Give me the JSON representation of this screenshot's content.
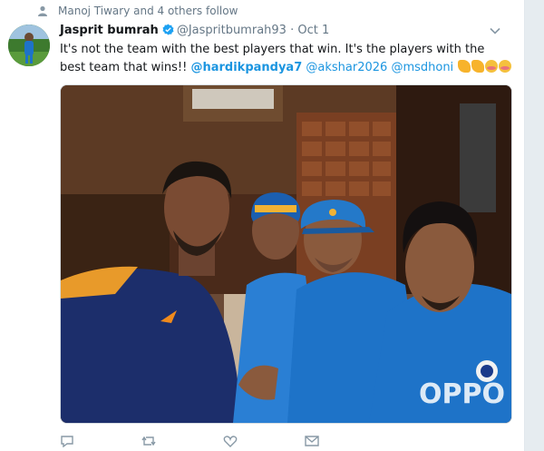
{
  "context": {
    "text": "Manoj Tiwary and 4 others follow",
    "icon": "person-icon"
  },
  "tweet": {
    "display_name": "Jasprit bumrah",
    "handle": "@Jaspritbumrah93",
    "separator": "·",
    "date": "Oct 1",
    "text_plain": "It's not the team with the best players that win. It's the players with the best team that wins!! ",
    "mentions": [
      "@hardikpandya7",
      "@akshar2026",
      "@msdhoni"
    ],
    "emojis": [
      "flexed-biceps-emoji",
      "flexed-biceps-emoji",
      "blushing-face-emoji",
      "blushing-face-emoji"
    ]
  },
  "photo": {
    "description_icon": "team-selfie-photo"
  },
  "actions": [
    "reply-icon",
    "retweet-icon",
    "like-icon",
    "message-icon"
  ],
  "colors": {
    "link": "#1b95e0",
    "verified": "#1da1f2",
    "meta": "#657786",
    "jersey": "#1e73c8"
  }
}
